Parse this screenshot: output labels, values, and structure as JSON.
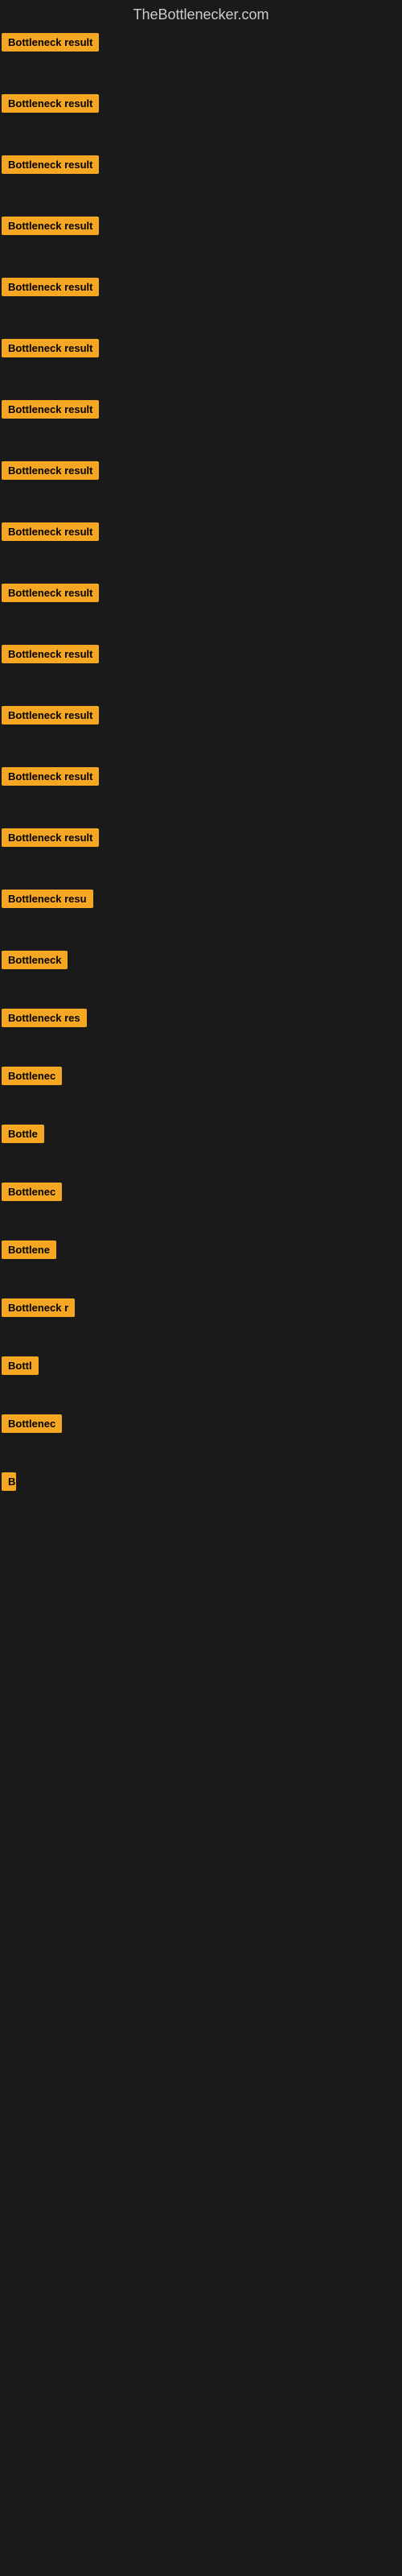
{
  "site": {
    "title": "TheBottlenecker.com"
  },
  "items": [
    {
      "id": 1,
      "label": "Bottleneck result",
      "width": 160,
      "margin_bottom": 48
    },
    {
      "id": 2,
      "label": "Bottleneck result",
      "width": 160,
      "margin_bottom": 48
    },
    {
      "id": 3,
      "label": "Bottleneck result",
      "width": 160,
      "margin_bottom": 48
    },
    {
      "id": 4,
      "label": "Bottleneck result",
      "width": 160,
      "margin_bottom": 48
    },
    {
      "id": 5,
      "label": "Bottleneck result",
      "width": 160,
      "margin_bottom": 48
    },
    {
      "id": 6,
      "label": "Bottleneck result",
      "width": 160,
      "margin_bottom": 48
    },
    {
      "id": 7,
      "label": "Bottleneck result",
      "width": 160,
      "margin_bottom": 48
    },
    {
      "id": 8,
      "label": "Bottleneck result",
      "width": 160,
      "margin_bottom": 48
    },
    {
      "id": 9,
      "label": "Bottleneck result",
      "width": 160,
      "margin_bottom": 48
    },
    {
      "id": 10,
      "label": "Bottleneck result",
      "width": 160,
      "margin_bottom": 48
    },
    {
      "id": 11,
      "label": "Bottleneck result",
      "width": 160,
      "margin_bottom": 48
    },
    {
      "id": 12,
      "label": "Bottleneck result",
      "width": 160,
      "margin_bottom": 48
    },
    {
      "id": 13,
      "label": "Bottleneck result",
      "width": 160,
      "margin_bottom": 48
    },
    {
      "id": 14,
      "label": "Bottleneck result",
      "width": 155,
      "margin_bottom": 48
    },
    {
      "id": 15,
      "label": "Bottleneck resu",
      "width": 140,
      "margin_bottom": 48
    },
    {
      "id": 16,
      "label": "Bottleneck",
      "width": 90,
      "margin_bottom": 44
    },
    {
      "id": 17,
      "label": "Bottleneck res",
      "width": 118,
      "margin_bottom": 44
    },
    {
      "id": 18,
      "label": "Bottlenec",
      "width": 80,
      "margin_bottom": 44
    },
    {
      "id": 19,
      "label": "Bottle",
      "width": 56,
      "margin_bottom": 44
    },
    {
      "id": 20,
      "label": "Bottlenec",
      "width": 80,
      "margin_bottom": 44
    },
    {
      "id": 21,
      "label": "Bottlene",
      "width": 70,
      "margin_bottom": 44
    },
    {
      "id": 22,
      "label": "Bottleneck r",
      "width": 100,
      "margin_bottom": 44
    },
    {
      "id": 23,
      "label": "Bottl",
      "width": 50,
      "margin_bottom": 44
    },
    {
      "id": 24,
      "label": "Bottlenec",
      "width": 78,
      "margin_bottom": 44
    },
    {
      "id": 25,
      "label": "B",
      "width": 18,
      "margin_bottom": 44
    }
  ],
  "colors": {
    "badge_bg": "#f5a623",
    "badge_text": "#000000",
    "background": "#1a1a1a",
    "title_text": "#cccccc"
  }
}
